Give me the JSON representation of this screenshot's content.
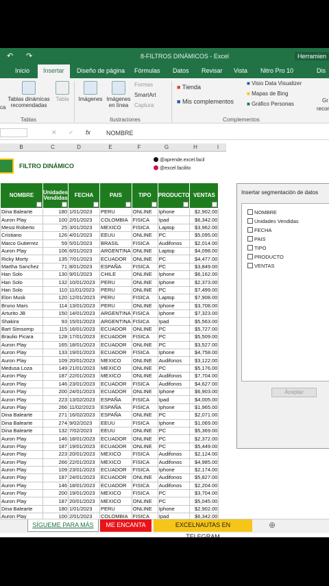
{
  "title_bar": {
    "title": "8-FILTROS DINÁMICOS - Excel",
    "tools": "Herramien",
    "undo": "↶",
    "redo": "↷"
  },
  "tabs": [
    "Inicio",
    "Insertar",
    "Diseño de página",
    "Fórmulas",
    "Datos",
    "Revisar",
    "Vista",
    "Nitro Pro 10",
    "Dis"
  ],
  "active_tab": "Insertar",
  "ribbon": {
    "dyn_tables": "Tablas dinámicas recomendadas",
    "table": "Tabla",
    "tables_group": "Tablas",
    "images": "Imágenes",
    "online_images": "Imágenes en línea",
    "shapes": "Formas",
    "smartart": "SmartArt",
    "capture": "Captura",
    "illus_group": "Ilustraciones",
    "store": "Tienda",
    "my_addins": "Mis complementos",
    "visio": "Visio Data Visualizer",
    "bing": "Mapas de Bing",
    "people": "Gráfico Personas",
    "addins_group": "Complementos",
    "left_frag": "ca",
    "right_frag1": "Gr",
    "right_frag2": "recon"
  },
  "formula_bar": {
    "fx": "fx",
    "value": "NOMBRE"
  },
  "columns": [
    "B",
    "C",
    "D",
    "E",
    "F",
    "G",
    "H",
    "I"
  ],
  "sheet_title": "FILTRO DINÁMICO",
  "social": {
    "ig": "@aprende.excel.facil",
    "tt": "@excel.facilito"
  },
  "headers": [
    "NOMBRE",
    "Unidades Vendidas",
    "FECHA",
    "PAIS",
    "TIPO",
    "PRODUCTO",
    "VENTAS"
  ],
  "rows": [
    [
      "Dina Balearte",
      "180",
      "1/01/2023",
      "PERU",
      "ONLINE",
      "Iphone",
      "$2,902.00"
    ],
    [
      "Auron Play",
      "100",
      "2/01/2023",
      "COLOMBIA",
      "FISICA",
      "Ipad",
      "$6,342.00"
    ],
    [
      "Messi Roberto",
      "25",
      "3/01/2023",
      "MEXICO",
      "FISICA",
      "Laptop",
      "$3,962.00"
    ],
    [
      "Cristiano",
      "126",
      "4/01/2023",
      "EEUU",
      "ONLINE",
      "PC",
      "$5,095.00"
    ],
    [
      "Marco Gutierrez",
      "59",
      "5/01/2023",
      "BRASIL",
      "FISICA",
      "Audifonos",
      "$2,014.00"
    ],
    [
      "Auron Play",
      "106",
      "6/01/2023",
      "ARGENTINA",
      "ONLINE",
      "Laptop",
      "$4,098.00"
    ],
    [
      "Ricky Morty",
      "135",
      "7/01/2023",
      "ECUADOR",
      "ONLINE",
      "PC",
      "$4,477.00"
    ],
    [
      "Martha Sanchez",
      "71",
      "8/01/2023",
      "ESPAÑA",
      "FISICA",
      "PC",
      "$3,849.00"
    ],
    [
      "Han Solo",
      "130",
      "9/01/2023",
      "CHILE",
      "ONLINE",
      "Iphone",
      "$6,162.00"
    ],
    [
      "Han Solo",
      "132",
      "10/01/2023",
      "PERU",
      "ONLINE",
      "Iphone",
      "$2,373.00"
    ],
    [
      "Han Solo",
      "110",
      "11/01/2023",
      "PERU",
      "ONLINE",
      "PC",
      "$7,499.00"
    ],
    [
      "Elon Musk",
      "120",
      "12/01/2023",
      "PERU",
      "FISICA",
      "Laptop",
      "$7,908.00"
    ],
    [
      "Bruno Mars",
      "114",
      "13/01/2023",
      "PERU",
      "ONLINE",
      "Iphone",
      "$3,708.00"
    ],
    [
      "Arturito JB",
      "150",
      "14/01/2023",
      "ARGENTINA",
      "FISICA",
      "Iphone",
      "$7,323.00"
    ],
    [
      "Shakira",
      "93",
      "15/01/2023",
      "ARGENTINA",
      "FISICA",
      "Ipad",
      "$5,563.00"
    ],
    [
      "Bart Simsomp",
      "115",
      "16/01/2023",
      "ECUADOR",
      "ONLINE",
      "PC",
      "$5,727.00"
    ],
    [
      "Braulio Picara",
      "128",
      "17/01/2023",
      "ECUADOR",
      "FISICA",
      "PC",
      "$5,509.00"
    ],
    [
      "Auron Play",
      "165",
      "18/01/2023",
      "ECUADOR",
      "ONLINE",
      "PC",
      "$3,527.00"
    ],
    [
      "Auron Play",
      "133",
      "19/01/2023",
      "ECUADOR",
      "FISICA",
      "Iphone",
      "$4,758.00"
    ],
    [
      "Auron Play",
      "109",
      "20/01/2023",
      "MEXICO",
      "ONLINE",
      "Audifonos",
      "$3,122.00"
    ],
    [
      "Medusa Loza",
      "149",
      "21/01/2023",
      "MEXICO",
      "ONLINE",
      "PC",
      "$5,176.00"
    ],
    [
      "Auron Play",
      "187",
      "22/01/2023",
      "MEXICO",
      "ONLINE",
      "Audifonos",
      "$7,704.00"
    ],
    [
      "Auron Play",
      "146",
      "23/01/2023",
      "ECUADOR",
      "FISICA",
      "Audifonos",
      "$4,627.00"
    ],
    [
      "Auron Play",
      "200",
      "24/01/2023",
      "ECUADOR",
      "ONLINE",
      "Iphone",
      "$6,903.00"
    ],
    [
      "Auron Play",
      "223",
      "13/02/2023",
      "ESPAÑA",
      "FISICA",
      "Ipad",
      "$4,005.00"
    ],
    [
      "Auron Play",
      "266",
      "11/02/2023",
      "ESPAÑA",
      "FISICA",
      "Iphone",
      "$1,965.00"
    ],
    [
      "Dina Balearte",
      "271",
      "16/02/2023",
      "ESPAÑA",
      "ONLINE",
      "PC",
      "$2,071.00"
    ],
    [
      "Dina Balearte",
      "274",
      "9/02/2023",
      "EEUU",
      "FISICA",
      "Iphone",
      "$1,069.00"
    ],
    [
      "Dina Balearte",
      "132",
      "7/02/2023",
      "EEUU",
      "ONLINE",
      "PC",
      "$5,369.00"
    ],
    [
      "Auron Play",
      "146",
      "18/01/2023",
      "ECUADOR",
      "ONLINE",
      "PC",
      "$2,372.00"
    ],
    [
      "Auron Play",
      "187",
      "19/01/2023",
      "ECUADOR",
      "ONLINE",
      "PC",
      "$5,449.00"
    ],
    [
      "Auron Play",
      "223",
      "20/01/2023",
      "MEXICO",
      "FISICA",
      "Audifonos",
      "$2,124.00"
    ],
    [
      "Auron Play",
      "266",
      "22/01/2023",
      "MEXICO",
      "FISICA",
      "Audifonos",
      "$4,985.00"
    ],
    [
      "Auron Play",
      "109",
      "23/01/2023",
      "ECUADOR",
      "FISICA",
      "Iphone",
      "$2,174.00"
    ],
    [
      "Auron Play",
      "187",
      "24/01/2023",
      "ECUADOR",
      "ONLINE",
      "Audifonos",
      "$5,827.00"
    ],
    [
      "Auron Play",
      "146",
      "18/01/2023",
      "ECUADOR",
      "FISICA",
      "Audifonos",
      "$2,204.00"
    ],
    [
      "Auron Play",
      "200",
      "19/01/2023",
      "MEXICO",
      "FISICA",
      "PC",
      "$3,704.00"
    ],
    [
      "Auron Play",
      "187",
      "20/01/2023",
      "MEXICO",
      "ONLINE",
      "PC",
      "$5,045.00"
    ],
    [
      "Dina Balearte",
      "180",
      "1/01/2023",
      "PERU",
      "ONLINE",
      "Iphone",
      "$2,902.00"
    ],
    [
      "Auron Play",
      "100",
      "2/01/2023",
      "COLOMBIA",
      "FISICA",
      "Ipad",
      "$6,342.00"
    ]
  ],
  "slicer": {
    "title": "Insertar segmentación de datos",
    "options": [
      "NOMBRE",
      "Unidades Vendidas",
      "FECHA",
      "PAIS",
      "TIPO",
      "PRODUCTO",
      "VENTAS"
    ],
    "ok": "Aceptar"
  },
  "sheet_tabs": [
    "SÍGUEME PARA MÁS",
    "ME ENCANTA",
    "EXCELNAUTAS EN TELEGRAM"
  ],
  "colors": {
    "excel_green": "#217346",
    "header_green": "#1e7c1e",
    "tab_red": "#e8141a",
    "tab_yellow": "#f5c518"
  }
}
